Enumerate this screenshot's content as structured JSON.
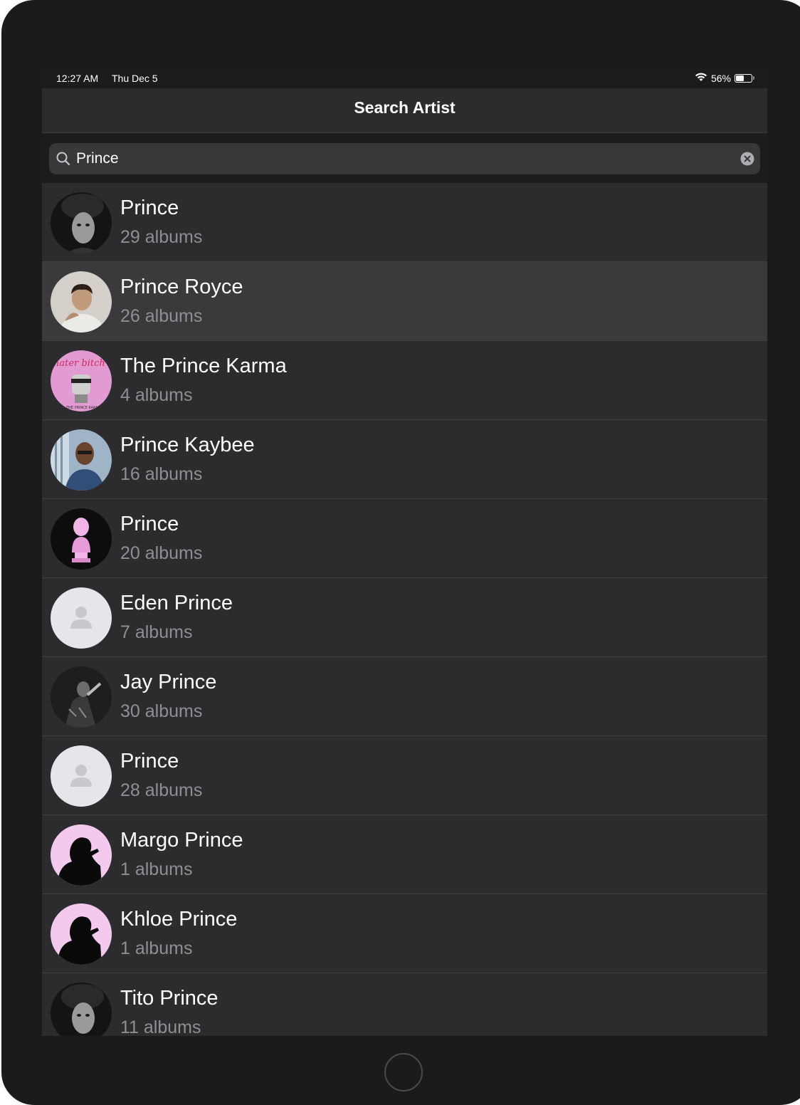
{
  "status_bar": {
    "time": "12:27 AM",
    "date": "Thu Dec 5",
    "battery_percent": "56%",
    "battery_level": 0.56
  },
  "nav": {
    "title": "Search Artist"
  },
  "search": {
    "value": "Prince"
  },
  "artists": [
    {
      "name": "Prince",
      "albums": "29 albums",
      "avatar": "bw-portrait"
    },
    {
      "name": "Prince Royce",
      "albums": "26 albums",
      "avatar": "man-photo"
    },
    {
      "name": "The Prince Karma",
      "albums": "4 albums",
      "avatar": "pink-artwork"
    },
    {
      "name": "Prince Kaybee",
      "albums": "16 albums",
      "avatar": "man-blue-shirt"
    },
    {
      "name": "Prince",
      "albums": "20 albums",
      "avatar": "pink-statue"
    },
    {
      "name": "Eden Prince",
      "albums": "7 albums",
      "avatar": "placeholder-person"
    },
    {
      "name": "Jay Prince",
      "albums": "30 albums",
      "avatar": "performer-photo"
    },
    {
      "name": "Prince",
      "albums": "28 albums",
      "avatar": "placeholder-person"
    },
    {
      "name": "Margo Prince",
      "albums": "1 albums",
      "avatar": "singer-silhouette"
    },
    {
      "name": "Khloe Prince",
      "albums": "1 albums",
      "avatar": "singer-silhouette"
    },
    {
      "name": "Tito Prince",
      "albums": "11 albums",
      "avatar": "bw-portrait"
    }
  ],
  "selected_index": 1
}
